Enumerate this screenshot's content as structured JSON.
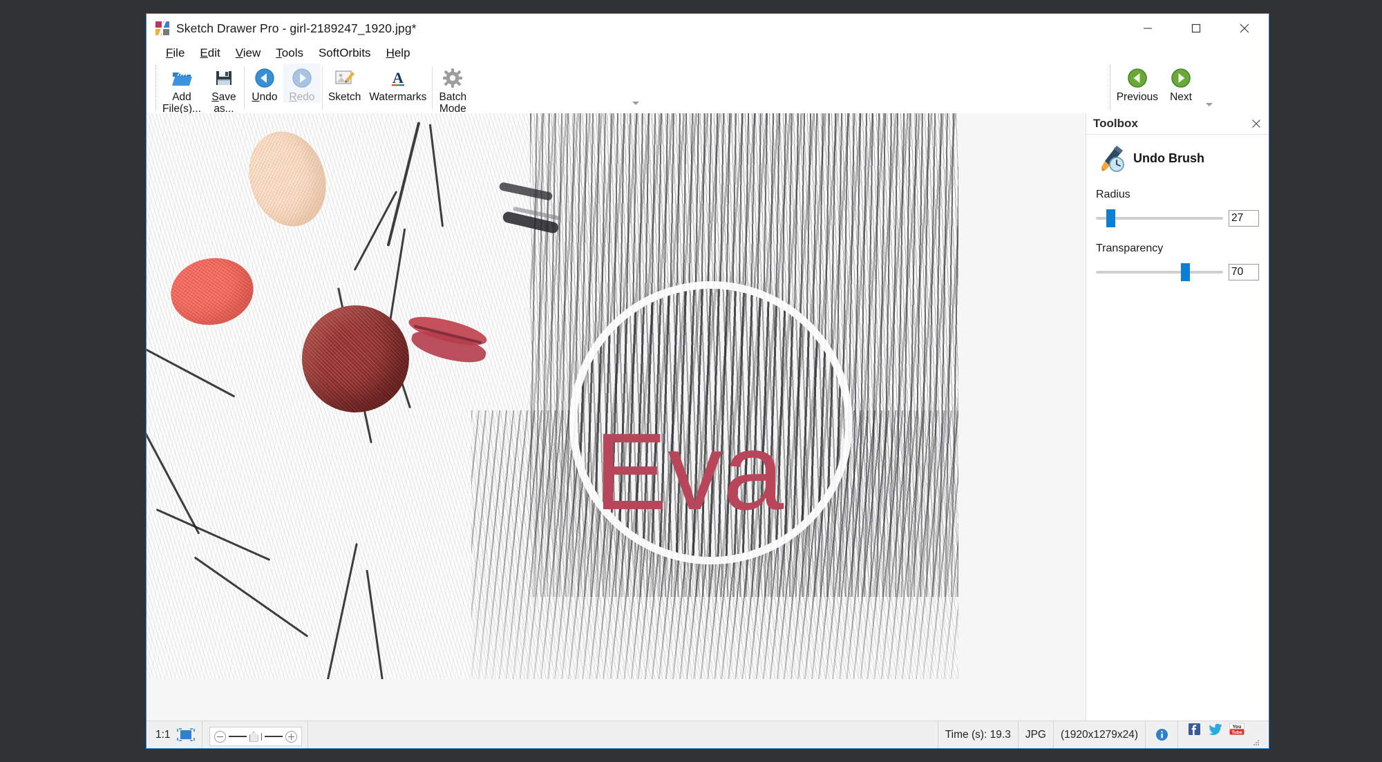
{
  "window": {
    "title": "Sketch Drawer Pro - girl-2189247_1920.jpg*",
    "app_icon": "sketch-drawer-logo-icon",
    "minimize_label": "minimize-icon",
    "maximize_label": "maximize-icon",
    "close_label": "close-icon"
  },
  "menubar": {
    "items": [
      {
        "label": "File",
        "accel": "F"
      },
      {
        "label": "Edit",
        "accel": "E"
      },
      {
        "label": "View",
        "accel": "V"
      },
      {
        "label": "Tools",
        "accel": "T"
      },
      {
        "label": "SoftOrbits",
        "accel": ""
      },
      {
        "label": "Help",
        "accel": "H"
      }
    ]
  },
  "toolbar": {
    "buttons": [
      {
        "name": "add-files",
        "label": "Add\nFile(s)...",
        "icon": "open-folder-icon",
        "enabled": true
      },
      {
        "name": "save-as",
        "label": "Save\nas...",
        "icon": "floppy-disk-icon",
        "enabled": true
      },
      {
        "name": "undo",
        "label": "Undo",
        "icon": "undo-arrow-icon",
        "enabled": true
      },
      {
        "name": "redo",
        "label": "Redo",
        "icon": "redo-arrow-icon",
        "enabled": false
      },
      {
        "name": "sketch",
        "label": "Sketch",
        "icon": "sketch-photo-icon",
        "enabled": true
      },
      {
        "name": "watermarks",
        "label": "Watermarks",
        "icon": "letter-a-icon",
        "enabled": true
      },
      {
        "name": "batch-mode",
        "label": "Batch\nMode",
        "icon": "gear-icon",
        "enabled": true
      }
    ],
    "nav": [
      {
        "name": "previous",
        "label": "Previous",
        "icon": "green-left-arrow-icon"
      },
      {
        "name": "next",
        "label": "Next",
        "icon": "green-right-arrow-icon"
      }
    ],
    "overflow_icon": "toolbar-overflow-icon"
  },
  "toolbox": {
    "title": "Toolbox",
    "close_icon": "close-icon",
    "tool": {
      "name": "Undo Brush",
      "icon": "undo-brush-icon"
    },
    "sliders": [
      {
        "name": "radius",
        "label": "Radius",
        "value": "27",
        "percent": 8
      },
      {
        "name": "transparency",
        "label": "Transparency",
        "value": "70",
        "percent": 69
      }
    ]
  },
  "canvas": {
    "watermark_text": "Eva",
    "watermark_color": "#b8455a",
    "image_description": "pencil-sketch-portrait-of-woman-with-christmas-ornaments"
  },
  "statusbar": {
    "zoom_ratio": "1:1",
    "fit_icon": "fit-to-window-icon",
    "zoom_out_icon": "zoom-out-icon",
    "zoom_in_icon": "zoom-in-icon",
    "time": "Time (s): 19.3",
    "format": "JPG",
    "dimensions": "(1920x1279x24)",
    "info_icon": "info-icon",
    "facebook_icon": "facebook-icon",
    "twitter_icon": "twitter-icon",
    "youtube_icon": "youtube-icon",
    "resize_grip_icon": "resize-grip-icon"
  }
}
